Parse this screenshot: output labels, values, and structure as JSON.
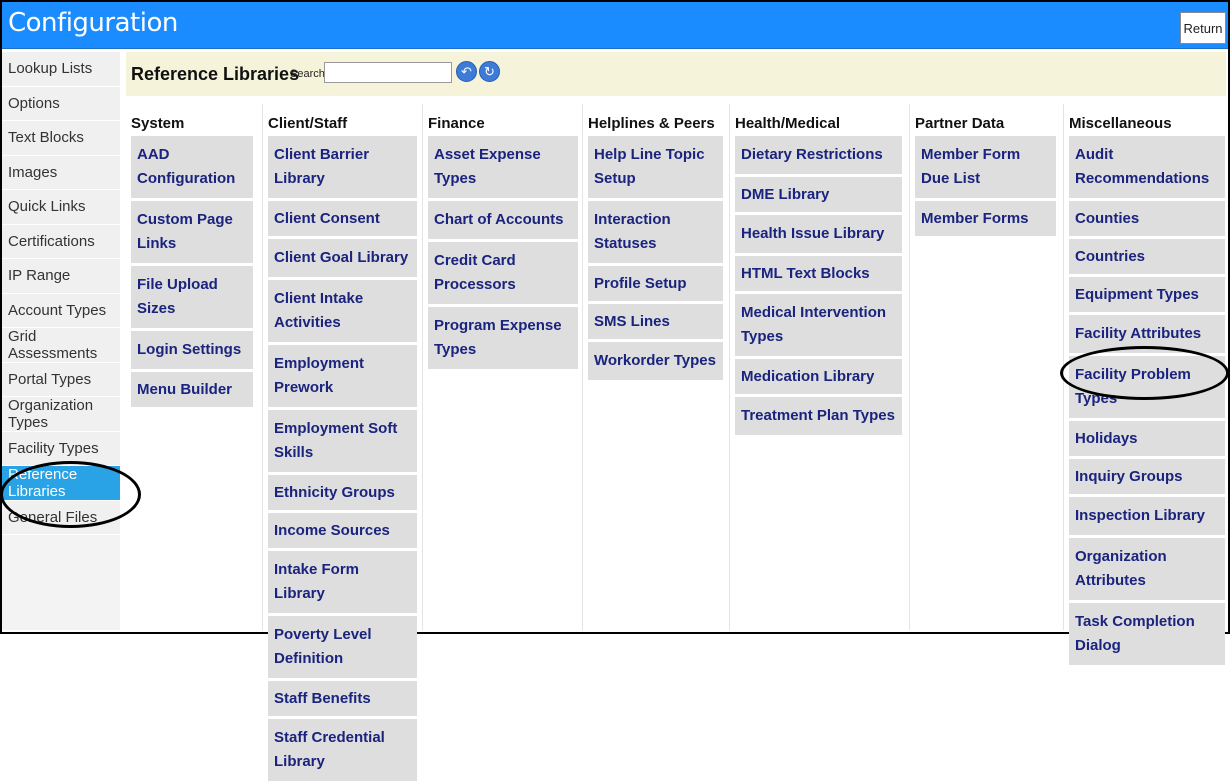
{
  "app": {
    "title": "Configuration",
    "return_label": "Return"
  },
  "sidebar": {
    "items": [
      {
        "label": "Lookup Lists"
      },
      {
        "label": "Options"
      },
      {
        "label": "Text Blocks"
      },
      {
        "label": "Images"
      },
      {
        "label": "Quick Links"
      },
      {
        "label": "Certifications"
      },
      {
        "label": "IP Range"
      },
      {
        "label": "Account Types"
      },
      {
        "label": "Grid Assessments"
      },
      {
        "label": "Portal Types"
      },
      {
        "label": "Organization Types"
      },
      {
        "label": "Facility Types"
      },
      {
        "label": "Reference Libraries",
        "active": true
      },
      {
        "label": "General Files"
      }
    ]
  },
  "header": {
    "title": "Reference Libraries",
    "search_label": "Search:",
    "search_value": ""
  },
  "icons": {
    "back": "back-arrow-icon",
    "refresh": "refresh-icon"
  },
  "columns": [
    {
      "title": "System",
      "items": [
        "AAD Configuration",
        "Custom Page Links",
        "File Upload Sizes",
        "Login Settings",
        "Menu Builder"
      ]
    },
    {
      "title": "Client/Staff",
      "items": [
        "Client Barrier Library",
        "Client Consent",
        "Client Goal Library",
        "Client Intake Activities",
        "Employment Prework",
        "Employment Soft Skills",
        "Ethnicity Groups",
        "Income Sources",
        "Intake Form Library",
        "Poverty Level Definition",
        "Staff Benefits",
        "Staff Credential Library"
      ]
    },
    {
      "title": "Finance",
      "items": [
        "Asset Expense Types",
        "Chart of Accounts",
        "Credit Card Processors",
        "Program Expense Types"
      ]
    },
    {
      "title": "Helplines & Peers",
      "items": [
        "Help Line Topic Setup",
        "Interaction Statuses",
        "Profile Setup",
        "SMS Lines",
        "Workorder Types"
      ]
    },
    {
      "title": "Health/Medical",
      "items": [
        "Dietary Restrictions",
        "DME Library",
        "Health Issue Library",
        "HTML Text Blocks",
        "Medical Intervention Types",
        "Medication Library",
        "Treatment Plan Types"
      ]
    },
    {
      "title": "Partner Data",
      "items": [
        "Member Form Due List",
        "Member Forms"
      ]
    },
    {
      "title": "Miscellaneous",
      "items": [
        "Audit Recommendations",
        "Counties",
        "Countries",
        "Equipment Types",
        "Facility Attributes",
        "Facility Problem Types",
        "Holidays",
        "Inquiry Groups",
        "Inspection Library",
        "Organization Attributes",
        "Task Completion Dialog"
      ]
    }
  ],
  "colors": {
    "topbar": "#1a8cff",
    "active_item": "#29a3e6",
    "link_text": "#1a237e",
    "header_bg": "#f5f3d9"
  }
}
